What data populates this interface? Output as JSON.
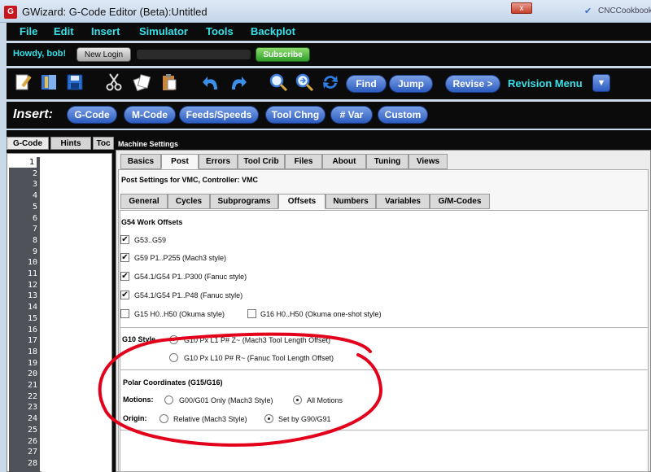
{
  "window": {
    "title": "GWizard: G-Code Editor (Beta):Untitled",
    "close_label": "x",
    "background_text": "CNCCookbook"
  },
  "menu": [
    "File",
    "Edit",
    "Insert",
    "Simulator",
    "Tools",
    "Backplot"
  ],
  "greeting": {
    "text": "Howdy, bob!",
    "new_login": "New Login",
    "subscribe": "Subscribe"
  },
  "toolbar": {
    "icons": [
      "new-document-icon",
      "open-book-icon",
      "save-disk-icon",
      "cut-scissors-icon",
      "copy-icon",
      "paste-clipboard-icon",
      "undo-icon",
      "redo-icon",
      "find-magnifier-icon",
      "find-next-magnifier-icon",
      "refresh-icon"
    ],
    "find": "Find",
    "jump": "Jump",
    "revise": "Revise >",
    "revision_menu": "Revision Menu",
    "dropdown": "▼"
  },
  "insert": {
    "label": "Insert:",
    "buttons": [
      "G-Code",
      "M-Code",
      "Feeds/Speeds",
      "Tool Chng",
      "# Var",
      "Custom"
    ]
  },
  "left_tabs": [
    "G-Code",
    "Hints",
    "Toc"
  ],
  "line_numbers": [
    "1",
    "2",
    "3",
    "4",
    "5",
    "6",
    "7",
    "8",
    "9",
    "10",
    "11",
    "12",
    "13",
    "14",
    "15",
    "16",
    "17",
    "18",
    "19",
    "20",
    "21",
    "22",
    "23",
    "24",
    "25",
    "26",
    "27",
    "28"
  ],
  "machine_settings": {
    "title": "Machine Settings",
    "tabs": [
      "Basics",
      "Post",
      "Errors",
      "Tool Crib",
      "Files",
      "About",
      "Tuning",
      "Views"
    ],
    "active_tab": "Post",
    "post_title": "Post Settings for VMC, Controller: VMC",
    "subtabs": [
      "General",
      "Cycles",
      "Subprograms",
      "Offsets",
      "Numbers",
      "Variables",
      "G/M-Codes"
    ],
    "active_subtab": "Offsets"
  },
  "offsets": {
    "work_offsets_title": "G54 Work Offsets",
    "checkboxes": [
      {
        "label": "G53..G59",
        "checked": true
      },
      {
        "label": "G59 P1..P255 (Mach3 style)",
        "checked": true
      },
      {
        "label": "G54.1/G54 P1..P300 (Fanuc style)",
        "checked": true
      },
      {
        "label": "G54.1/G54 P1..P48 (Fanuc style)",
        "checked": true
      },
      {
        "label": "G15 H0..H50 (Okuma style)",
        "checked": false
      },
      {
        "label": "G16 H0..H50 (Okuma one-shot style)",
        "checked": false
      }
    ],
    "g10_title": "G10 Style",
    "g10_options": [
      {
        "label": "G10 Px L1 P# Z~ (Mach3 Tool Length Offset)",
        "selected": true
      },
      {
        "label": "G10 Px L10 P# R~ (Fanuc Tool Length Offset)",
        "selected": false
      }
    ],
    "polar_title": "Polar Coordinates (G15/G16)",
    "motions_label": "Motions:",
    "motions_options": [
      {
        "label": "G00/G01 Only (Mach3 Style)",
        "selected": false
      },
      {
        "label": "All Motions",
        "selected": true
      }
    ],
    "origin_label": "Origin:",
    "origin_options": [
      {
        "label": "Relative (Mach3 Style)",
        "selected": false
      },
      {
        "label": "Set by G90/G91",
        "selected": true
      }
    ]
  },
  "colors": {
    "accent_cyan": "#36e0e8",
    "pill_blue": "#2d5cc0",
    "subscribe_green": "#2f9e2a",
    "annotation_red": "#e3001b"
  }
}
